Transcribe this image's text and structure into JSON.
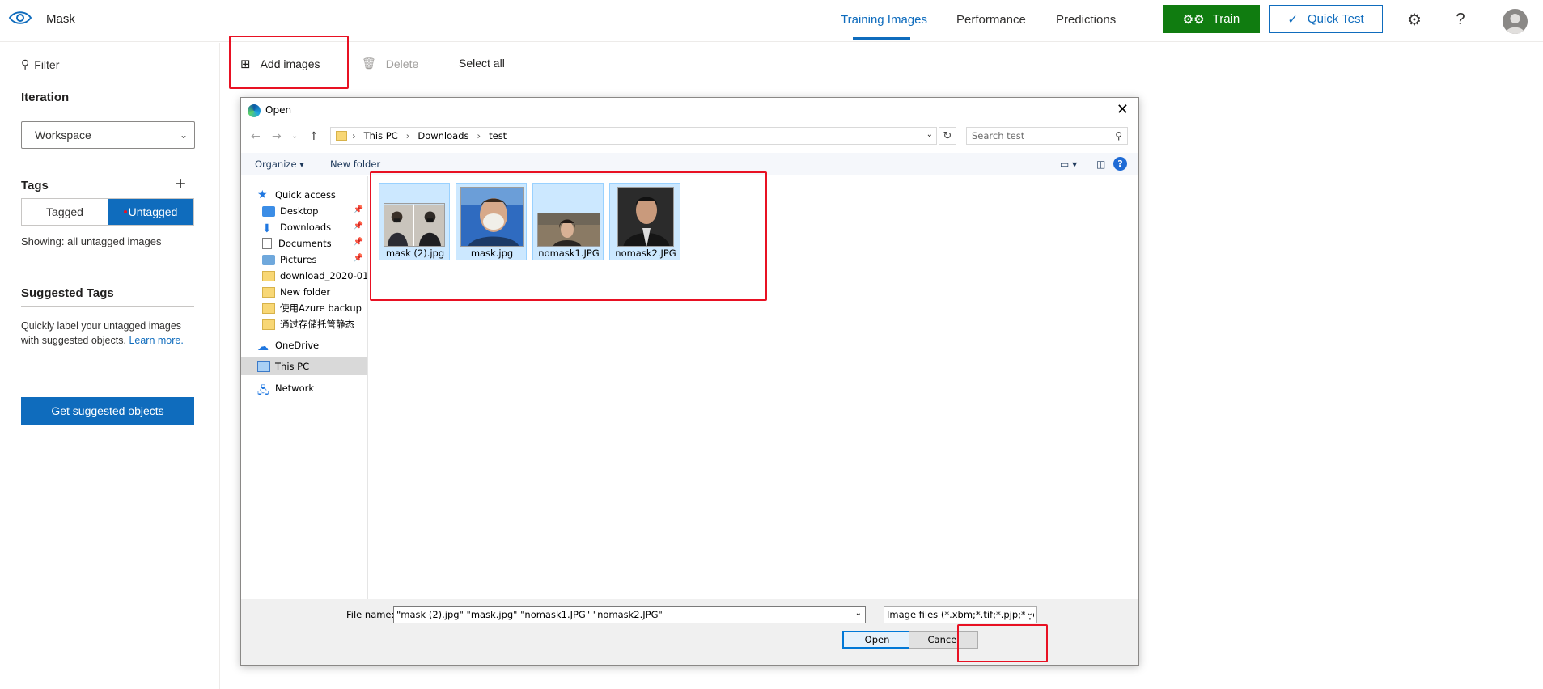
{
  "app": {
    "name": "Mask"
  },
  "nav": {
    "tabs": [
      "Training Images",
      "Performance",
      "Predictions"
    ]
  },
  "actions": {
    "train": "Train",
    "quick_test": "Quick Test"
  },
  "top_icons": {
    "settings": "gear-icon",
    "help": "?"
  },
  "sidebar": {
    "filter": "Filter",
    "iteration_label": "Iteration",
    "iteration_value": "Workspace",
    "tags_label": "Tags",
    "tag_options": [
      "Tagged",
      "Untagged"
    ],
    "showing": "Showing: all untagged images",
    "suggested_label": "Suggested Tags",
    "suggested_desc": "Quickly label your untagged images with suggested objects.",
    "learn_more": "Learn more.",
    "suggested_button": "Get suggested objects"
  },
  "toolbar": {
    "add_images": "Add images",
    "delete": "Delete",
    "select_all": "Select all"
  },
  "dialog": {
    "title": "Open",
    "breadcrumb": [
      "This PC",
      "Downloads",
      "test"
    ],
    "search_placeholder": "Search test",
    "organize": "Organize ▾",
    "new_folder": "New folder",
    "nav_items": [
      "Quick access",
      "Desktop",
      "Downloads",
      "Documents",
      "Pictures",
      "download_2020-01-",
      "New folder",
      "使用Azure backup",
      "通过存储托管静态",
      "OneDrive",
      "This PC",
      "Network"
    ],
    "files": [
      "mask (2).jpg",
      "mask.jpg",
      "nomask1.JPG",
      "nomask2.JPG"
    ],
    "file_name_label": "File name:",
    "file_name_value": "\"mask (2).jpg\" \"mask.jpg\" \"nomask1.JPG\" \"nomask2.JPG\"",
    "file_type": "Image files (*.xbm;*.tif;*.pjp;*.p",
    "open_button": "Open",
    "cancel_button": "Cancel"
  },
  "colors": {
    "accent": "#0f6cbd",
    "train": "#107c10",
    "highlight": "#e81123"
  }
}
